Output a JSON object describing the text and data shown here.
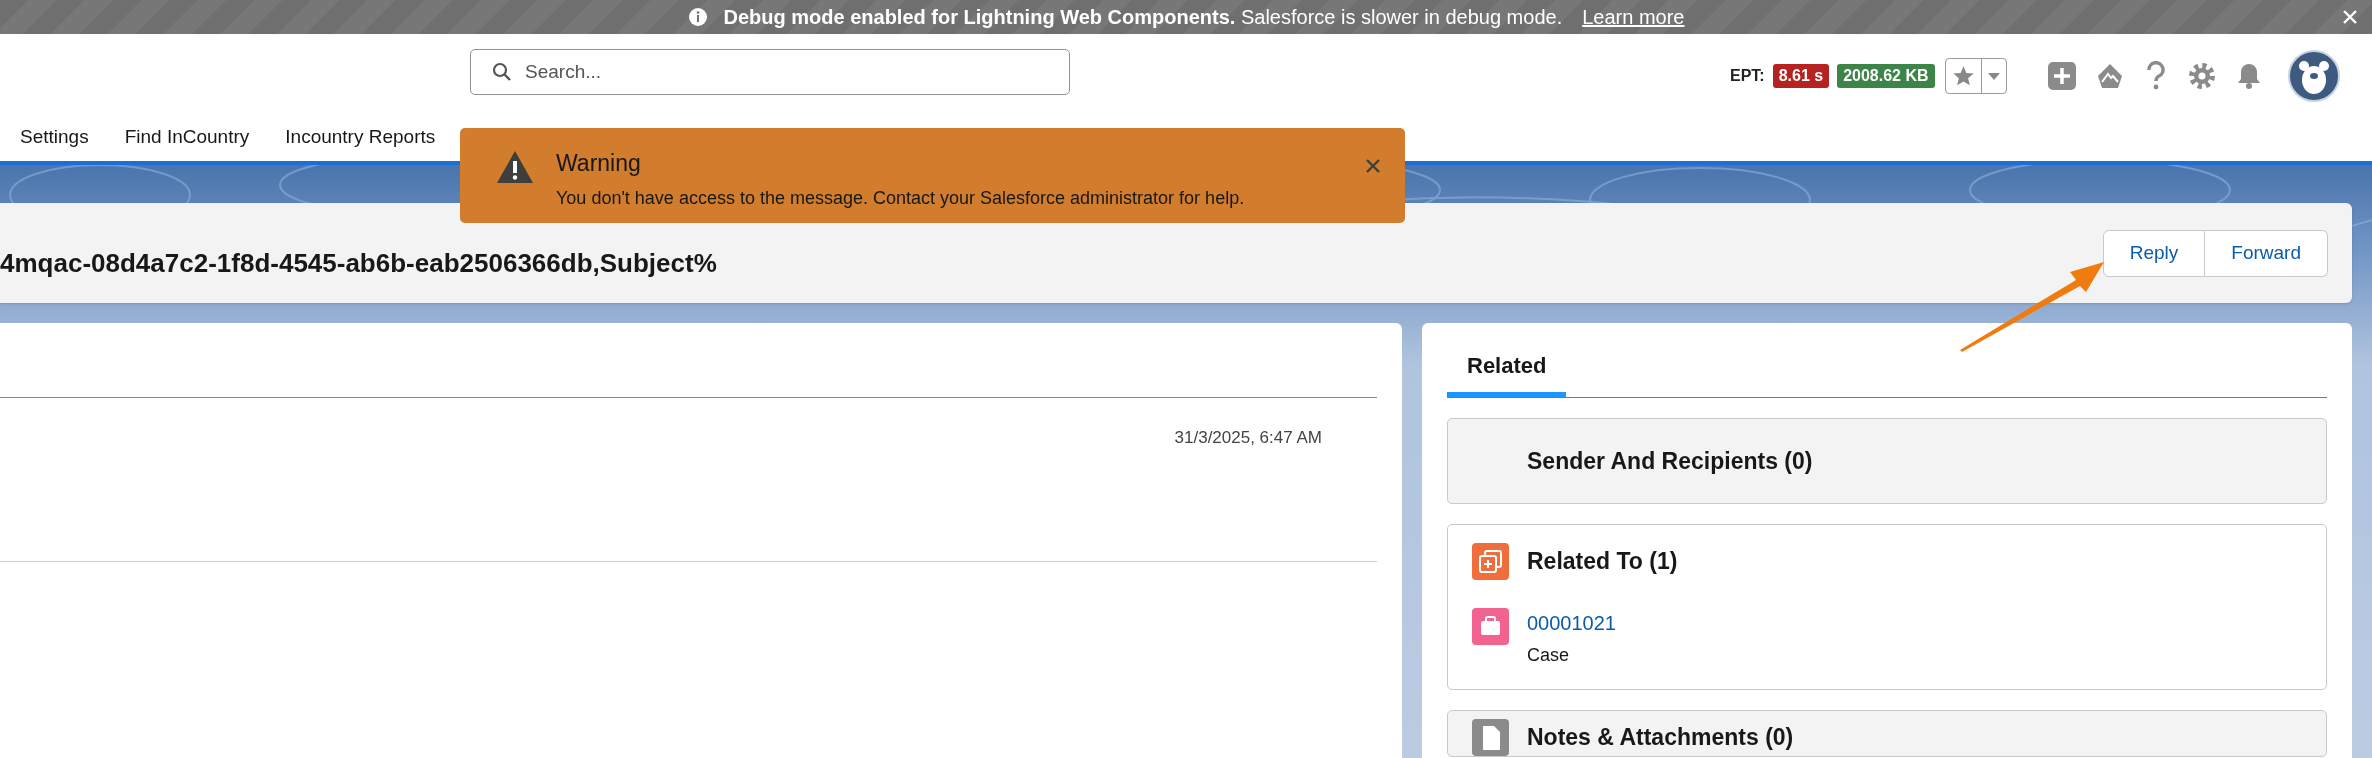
{
  "debug_banner": {
    "bold_text": "Debug mode enabled for Lightning Web Components.",
    "text": "Salesforce is slower in debug mode.",
    "link": "Learn more"
  },
  "header": {
    "search": {
      "placeholder": "Search..."
    },
    "ept_label": "EPT:",
    "ept_time": "8.61 s",
    "ept_size": "2008.62 KB"
  },
  "nav": [
    {
      "label": "Settings"
    },
    {
      "label": "Find InCountry"
    },
    {
      "label": "Incountry Reports"
    }
  ],
  "toast": {
    "title": "Warning",
    "message": "You don't have access to the message. Contact your Salesforce administrator for help."
  },
  "record": {
    "title": "4mqac-08d4a7c2-1f8d-4545-ab6b-eab2506366db,Subject%",
    "actions": [
      "Reply",
      "Forward"
    ]
  },
  "message": {
    "date": "31/3/2025, 6:47 AM"
  },
  "related": {
    "tabs": [
      {
        "label": "Related",
        "selected": true
      }
    ],
    "lists": [
      {
        "kind": "plain",
        "title": "Sender And Recipients (0)"
      },
      {
        "kind": "related",
        "title": "Related To (1)",
        "items": [
          {
            "link": "00001021",
            "type": "Case"
          }
        ]
      },
      {
        "kind": "notes",
        "title": "Notes & Attachments (0)"
      }
    ]
  }
}
